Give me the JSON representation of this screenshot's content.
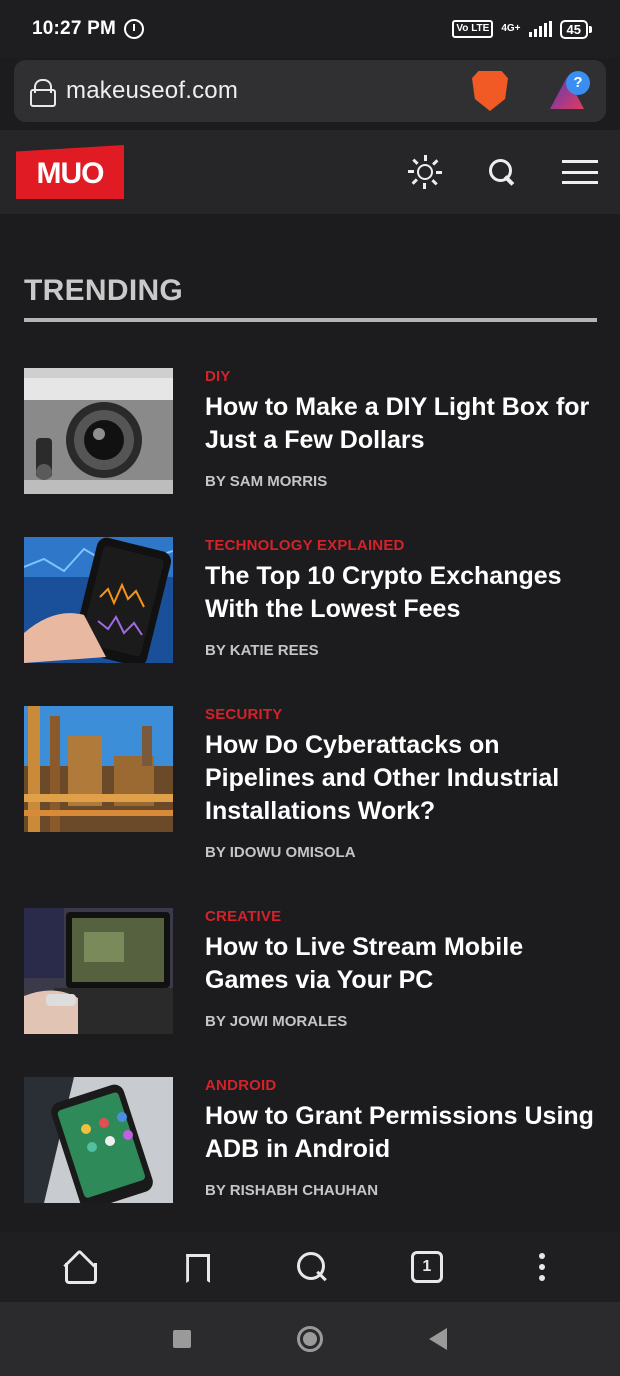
{
  "status": {
    "time": "10:27 PM",
    "network": "4G+",
    "volte": "Vo LTE",
    "battery": "45"
  },
  "browser": {
    "url": "makeuseof.com",
    "brave_icon": "brave-lion-icon",
    "rewards_badge": "?"
  },
  "site": {
    "logo": "MUO"
  },
  "section": {
    "title": "TRENDING"
  },
  "articles": [
    {
      "category": "DIY",
      "title": "How to Make a DIY Light Box for Just a Few Dollars",
      "byline": "BY SAM MORRIS",
      "thumb": "camera"
    },
    {
      "category": "TECHNOLOGY EXPLAINED",
      "title": "The Top 10 Crypto Exchanges With the Lowest Fees",
      "byline": "BY KATIE REES",
      "thumb": "phone-chart"
    },
    {
      "category": "SECURITY",
      "title": "How Do Cyberattacks on Pipelines and Other Industrial Installations Work?",
      "byline": "BY IDOWU OMISOLA",
      "thumb": "industrial"
    },
    {
      "category": "CREATIVE",
      "title": "How to Live Stream Mobile Games via Your PC",
      "byline": "BY JOWI MORALES",
      "thumb": "laptop-game"
    },
    {
      "category": "ANDROID",
      "title": "How to Grant Permissions Using ADB in Android",
      "byline": "BY RISHABH CHAUHAN",
      "thumb": "android-phone"
    }
  ],
  "bottom_nav": {
    "tab_count": "1"
  },
  "colors": {
    "accent": "#d4222a",
    "logo_red": "#e01b24",
    "background": "#1c1c1e"
  }
}
